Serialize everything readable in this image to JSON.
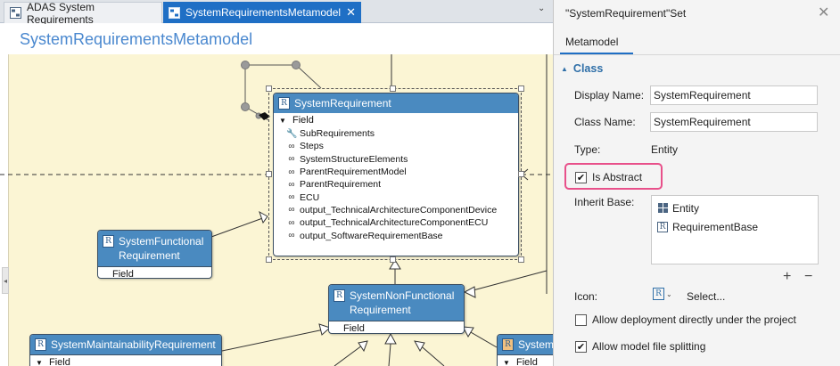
{
  "tabs": [
    {
      "label": "ADAS System Requirements",
      "active": false
    },
    {
      "label": "SystemRequirementsMetamodel",
      "active": true,
      "close": "✕"
    }
  ],
  "tab_dropdown": "⌄",
  "canvas_title": "SystemRequirementsMetamodel",
  "diagram": {
    "system_requirement": {
      "title": "SystemRequirement",
      "section": "Field",
      "fields": [
        {
          "icon": "wrench-icon",
          "label": "SubRequirements"
        },
        {
          "icon": "link-icon",
          "label": "Steps"
        },
        {
          "icon": "link-icon",
          "label": "SystemStructureElements"
        },
        {
          "icon": "link-icon",
          "label": "ParentRequirementModel"
        },
        {
          "icon": "link-icon",
          "label": "ParentRequirement"
        },
        {
          "icon": "link-icon",
          "label": "ECU"
        },
        {
          "icon": "link-icon",
          "label": "output_TechnicalArchitectureComponentDevice"
        },
        {
          "icon": "link-icon",
          "label": "output_TechnicalArchitectureComponentECU"
        },
        {
          "icon": "link-icon",
          "label": "output_SoftwareRequirementBase"
        }
      ]
    },
    "system_functional": {
      "title_line1": "SystemFunctional",
      "title_line2": "Requirement",
      "section": "Field"
    },
    "system_nonfunctional": {
      "title_line1": "SystemNonFunctional",
      "title_line2": "Requirement",
      "section": "Field"
    },
    "system_maintainability": {
      "title": "SystemMaintainabilityRequirement",
      "section": "Field"
    },
    "system_partial": {
      "title": "System",
      "section": "Field"
    }
  },
  "panel": {
    "title": "\"SystemRequirement\"Set",
    "tab": "Metamodel",
    "section": "Class",
    "display_name_label": "Display Name:",
    "display_name_value": "SystemRequirement",
    "class_name_label": "Class Name:",
    "class_name_value": "SystemRequirement",
    "type_label": "Type:",
    "type_value": "Entity",
    "is_abstract_label": "Is Abstract",
    "is_abstract_checked": true,
    "inherit_base_label": "Inherit Base:",
    "inherit_base": [
      "Entity",
      "RequirementBase"
    ],
    "plus": "+",
    "minus": "−",
    "icon_label": "Icon:",
    "select_label": "Select...",
    "allow_deployment_label": "Allow deployment directly under the project",
    "allow_deployment_checked": false,
    "allow_splitting_label": "Allow model file splitting",
    "allow_splitting_checked": true
  },
  "colors": {
    "accent": "#1f6fc5",
    "class_header": "#4a8ac0",
    "canvas_bg": "#fbf5d4",
    "highlight": "#e8508a"
  }
}
